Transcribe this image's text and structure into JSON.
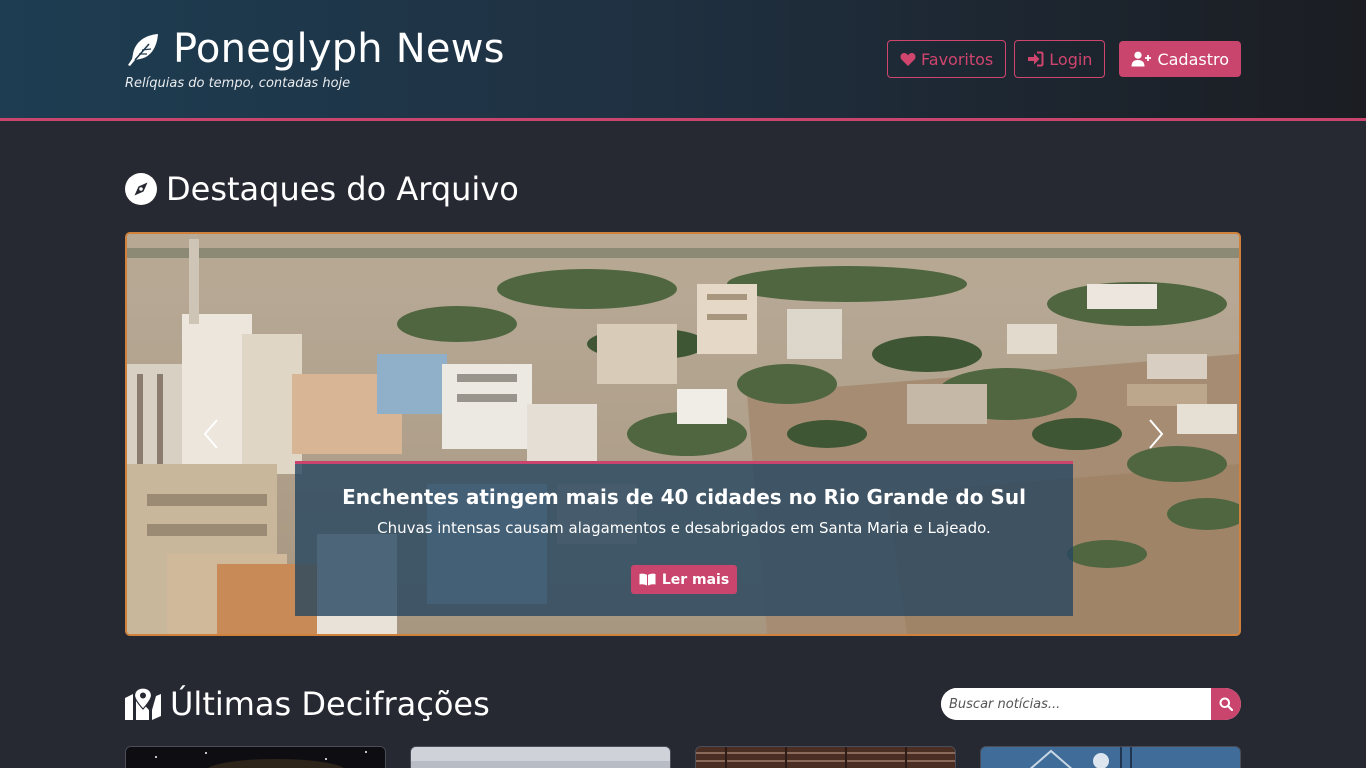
{
  "header": {
    "title": "Poneglyph News",
    "tagline": "Relíquias do tempo, contadas hoje",
    "buttons": {
      "favorites": "Favoritos",
      "login": "Login",
      "signup": "Cadastro"
    }
  },
  "highlights": {
    "title": "Destaques do Arquivo",
    "slide": {
      "headline": "Enchentes atingem mais de 40 cidades no Rio Grande do Sul",
      "summary": "Chuvas intensas causam alagamentos e desabrigados em Santa Maria e Lajeado.",
      "read_more": "Ler mais"
    }
  },
  "latest": {
    "title": "Últimas Decifrações",
    "search_placeholder": "Buscar notícias..."
  },
  "icons": {
    "brand": "feather-icon",
    "favorites": "heart-icon",
    "login": "sign-in-icon",
    "signup": "user-plus-icon",
    "highlights": "compass-icon",
    "latest": "map-marker-icon",
    "read_more": "book-open-icon",
    "search": "search-icon"
  },
  "colors": {
    "accent": "#c9456d",
    "page_background": "#262832",
    "carousel_border": "#d0823c"
  }
}
